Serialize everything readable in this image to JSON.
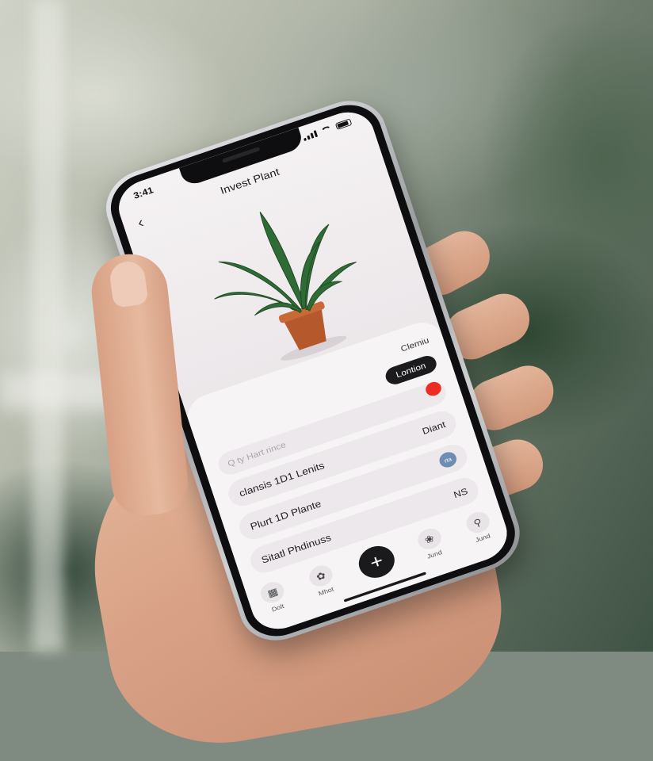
{
  "status_bar": {
    "time": "3:41"
  },
  "header": {
    "title": "Invest Plant"
  },
  "panel": {
    "top_label": "Clemiu",
    "dark_pill_label": "Lontion",
    "search_placeholder": "Q ty Hart rince",
    "items": [
      {
        "label": "clansis 1D1 Lenits",
        "trailing": "Diant"
      },
      {
        "label": "Plurt 1D Plante",
        "trailing": "NS"
      },
      {
        "label": "Sitatl Phdinuss",
        "trailing": ""
      }
    ],
    "chip_label": "rta"
  },
  "tab_bar": {
    "tabs": [
      {
        "label": "Dolt",
        "icon": "grid-icon"
      },
      {
        "label": "Mhot",
        "icon": "leaf-icon"
      },
      {
        "label": "",
        "icon": "plus-icon"
      },
      {
        "label": "Jund",
        "icon": "flower-icon"
      },
      {
        "label": "Jund",
        "icon": "search-icon"
      }
    ]
  },
  "colors": {
    "accent_red": "#ec2e22",
    "dark_pill": "#1b1b1d",
    "chip_blue": "#6f8db3"
  }
}
